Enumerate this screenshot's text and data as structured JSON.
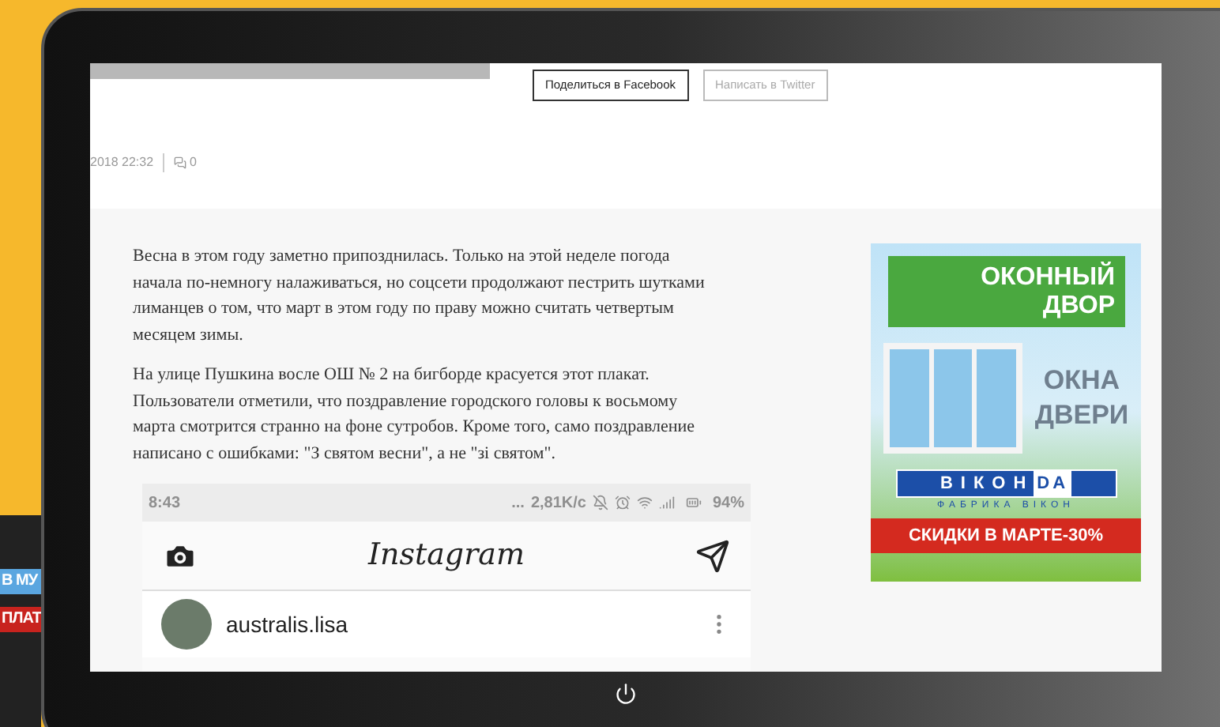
{
  "background_device": {
    "lines": [
      "В МУ",
      "ПЛАТ"
    ]
  },
  "share_buttons": [
    {
      "label": "Поделиться в Facebook",
      "disabled": false
    },
    {
      "label": "Написать в Twitter",
      "disabled": true
    }
  ],
  "meta": {
    "date": "2018 22:32",
    "comments": "0"
  },
  "article": {
    "paragraphs": [
      "Весна в этом году заметно припозднилась. Только на этой неделе погода начала по-немногу налаживаться, но соцсети продолжают пестрить шутками лиманцев о том, что март в этом году по праву можно считать четвертым месяцем зимы.",
      "На улице Пушкина восле ОШ № 2 на бигборде красуется этот плакат. Пользователи отметили, что поздравление городского головы к восьмому марта смотрится странно на фоне сутробов. Кроме того, само поздравление написано с ошибками: \"З святом весни\", а не \"зі святом\"."
    ]
  },
  "ad": {
    "brand_top": "ОКОННЫЙ",
    "brand_bottom": "ДВОР",
    "offer_lines": [
      "ОКНА",
      "ДВЕРИ"
    ],
    "logo_left": "ВIКОН",
    "logo_right": "DA",
    "logo_caption": "ФАБРИКА ВIКОН",
    "promo": "СКИДКИ В МАРТЕ-30%"
  },
  "embedded_screenshot": {
    "status_bar": {
      "time": "8:43",
      "dots": "...",
      "speed": "2,81K/c",
      "battery": "94%"
    },
    "app_title": "Instagram",
    "username": "australis.lisa"
  }
}
